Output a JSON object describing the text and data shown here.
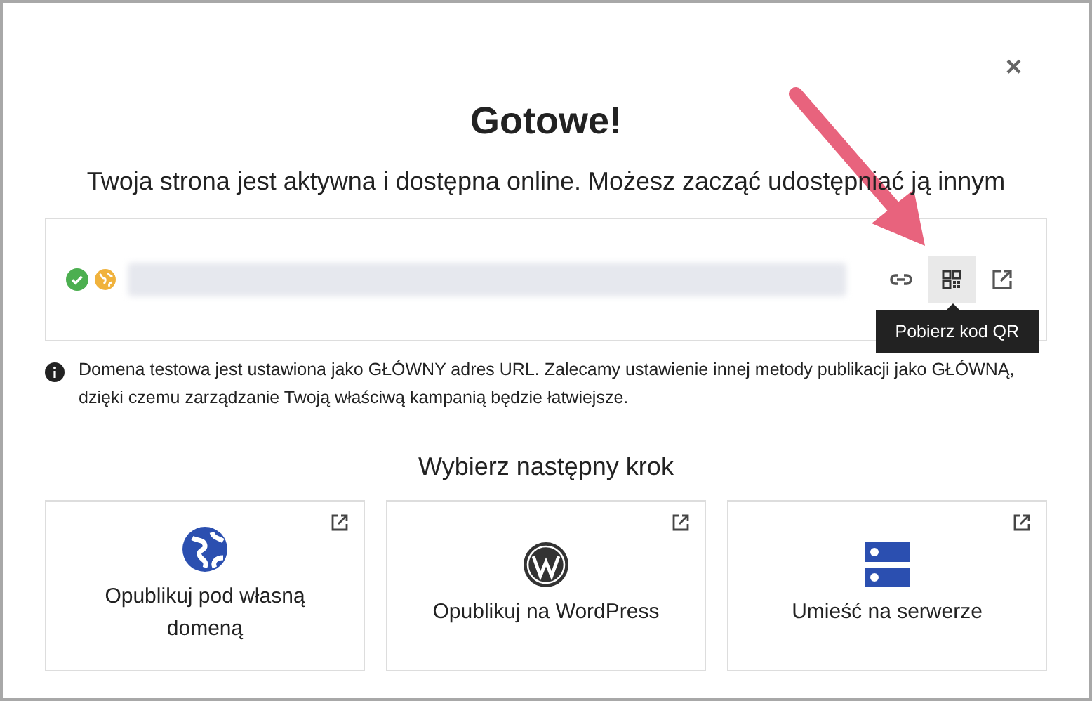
{
  "dialog": {
    "close": "×",
    "title": "Gotowe!",
    "subtitle": "Twoja strona jest aktywna i dostępna online. Możesz zacząć udostępniać ją innym",
    "url_box": {
      "tooltip": "Pobierz kod QR",
      "actions": [
        {
          "kind": "link",
          "selected": false
        },
        {
          "kind": "qr",
          "selected": true
        },
        {
          "kind": "external",
          "selected": false
        }
      ]
    },
    "notice": "Domena testowa jest ustawiona jako GŁÓWNY adres URL. Zalecamy ustawienie innej metody publikacji jako GŁÓWNĄ, dzięki czemu zarządzanie Twoją właściwą kampanią będzie łatwiejsze.",
    "next_heading": "Wybierz następny krok",
    "options": [
      {
        "kind": "domain",
        "label": "Opublikuj pod własną domeną"
      },
      {
        "kind": "wordpress",
        "label": "Opublikuj na WordPress"
      },
      {
        "kind": "server",
        "label": "Umieść na serwerze"
      }
    ]
  }
}
